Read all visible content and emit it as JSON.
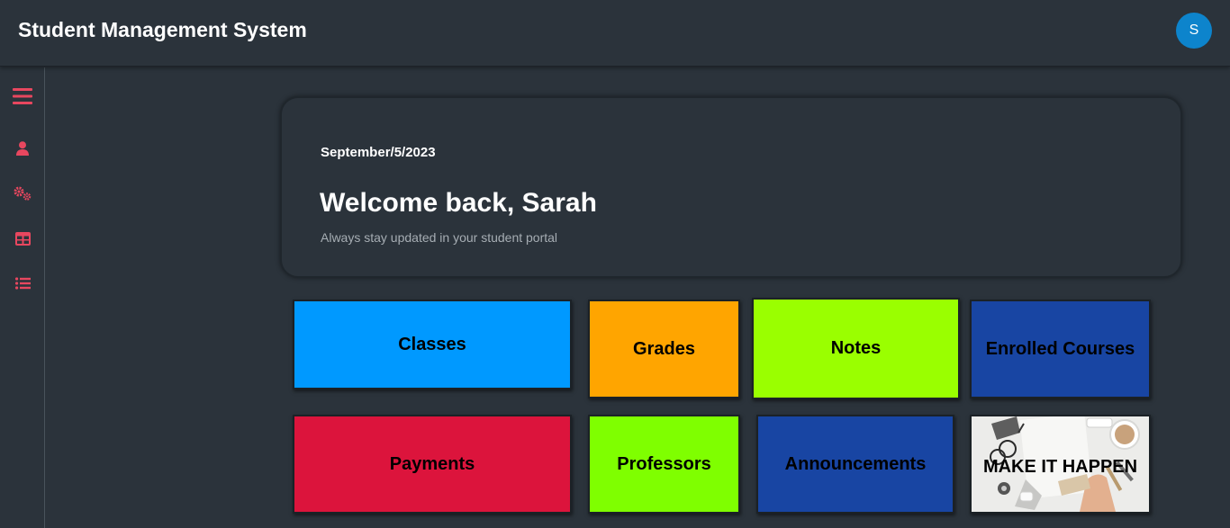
{
  "header": {
    "app_title": "Student Management System",
    "avatar_initial": "S",
    "avatar_color": "#0d84cc"
  },
  "sidebar": {
    "accent_color": "#e8475f",
    "items": [
      {
        "icon": "hamburger-menu-icon"
      },
      {
        "icon": "user-icon"
      },
      {
        "icon": "gears-icon"
      },
      {
        "icon": "table-icon"
      },
      {
        "icon": "list-icon"
      }
    ]
  },
  "welcome": {
    "date": "September/5/2023",
    "heading": "Welcome back, Sarah",
    "subtitle": "Always stay updated in your student portal"
  },
  "tiles": [
    {
      "label": "Classes",
      "color": "#0099ff"
    },
    {
      "label": "Grades",
      "color": "#ffa500"
    },
    {
      "label": "Notes",
      "color": "#9aff00"
    },
    {
      "label": "Enrolled Courses",
      "color": "#1845a3"
    },
    {
      "label": "Payments",
      "color": "#dc143c"
    },
    {
      "label": "Professors",
      "color": "#7fff00"
    },
    {
      "label": "Announcements",
      "color": "#1845a3"
    },
    {
      "label": "MAKE IT HAPPEN",
      "color": "#e9e9e7"
    }
  ]
}
